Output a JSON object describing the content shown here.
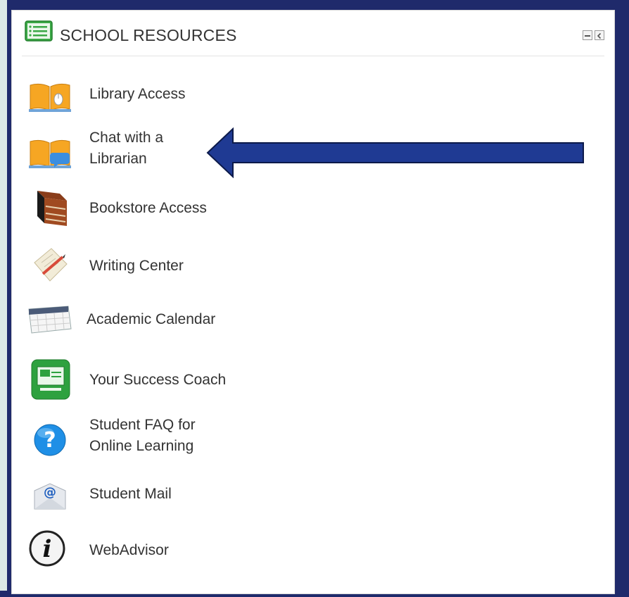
{
  "panel": {
    "title": "SCHOOL RESOURCES",
    "header_icon": "list-icon",
    "controls": [
      "collapse-icon",
      "dock-icon"
    ]
  },
  "items": [
    {
      "label": "Library Access",
      "icon": "open-book-mouse-icon"
    },
    {
      "label": "Chat with a\nLibrarian",
      "icon": "open-book-chat-icon"
    },
    {
      "label": "Bookstore Access",
      "icon": "book-stack-icon"
    },
    {
      "label": "Writing Center",
      "icon": "paper-pencil-icon"
    },
    {
      "label": "Academic Calendar",
      "icon": "calendar-icon"
    },
    {
      "label": "Your Success Coach",
      "icon": "presentation-board-icon"
    },
    {
      "label": "Student FAQ for\nOnline Learning",
      "icon": "question-icon"
    },
    {
      "label": "Student Mail",
      "icon": "at-mail-icon"
    },
    {
      "label": "WebAdvisor",
      "icon": "info-icon"
    }
  ],
  "annotation": {
    "type": "arrow",
    "points_to": "Chat with a Librarian",
    "color": "#1f3a93"
  },
  "colors": {
    "frame": "#1f2a6b",
    "accent_green": "#3aa845",
    "arrow_fill": "#1f3a93"
  }
}
